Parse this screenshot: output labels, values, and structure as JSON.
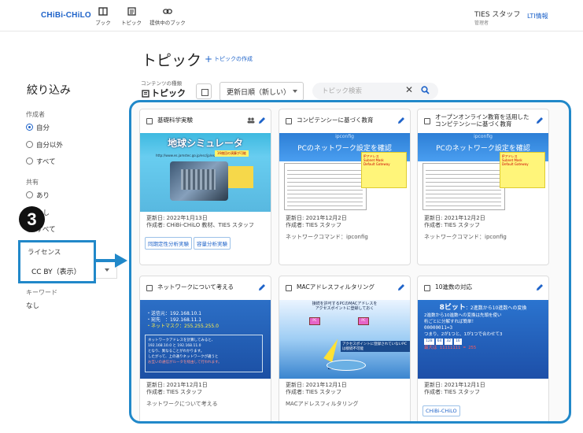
{
  "header": {
    "logo": "CHiBi-CHiLO",
    "nav": [
      {
        "label": "ブック",
        "icon": "book-icon"
      },
      {
        "label": "トピック",
        "icon": "topic-icon"
      },
      {
        "label": "提供中のブック",
        "icon": "link-icon"
      }
    ],
    "user_name": "TIES スタッフ",
    "user_role": "管理者",
    "lti_link": "LTI情報"
  },
  "page": {
    "title": "トピック",
    "add_topic": "トピックの作成"
  },
  "toolbar": {
    "content_type_label": "コンテンツの種類",
    "content_type_value": "トピック",
    "sort_value": "更新日順（新しい）",
    "search_placeholder": "トピック検索",
    "clear_icon": "✕"
  },
  "sidebar": {
    "title": "絞り込み",
    "author_label": "作成者",
    "author_options": [
      {
        "label": "自分",
        "selected": true
      },
      {
        "label": "自分以外",
        "selected": false
      },
      {
        "label": "すべて",
        "selected": false
      }
    ],
    "share_label": "共有",
    "share_options": [
      {
        "label": "あり",
        "selected": false
      },
      {
        "label": "なし",
        "selected": false
      },
      {
        "label": "すべて",
        "selected": false
      }
    ],
    "license_label": "ライセンス",
    "license_value": "CC BY（表示）",
    "keyword_label": "キーワード",
    "keyword_value": "なし"
  },
  "annotation": {
    "step": "3",
    "accent": "#2188c9"
  },
  "cards": [
    {
      "title": "基礎科学実験",
      "thumb_title": "地球シミュレータ",
      "thumb_strip": "http://www.es.jamstec.go.jp/esc/jp/es/hardware/index.html",
      "thumb_badge": "16億回の演算が可能",
      "updated": "更新日: 2022年1月13日",
      "author": "作成者: CHiBi-CHiLO 教材、TIES スタッフ",
      "tags": [
        "同期定性分析実験",
        "容量分析実験"
      ]
    },
    {
      "title": "コンピテンシーに基づく教育",
      "thumb_small": "ipconfig",
      "thumb_big": "PCのネットワーク設定を確認",
      "thumb_note": [
        "IPアドレス",
        "Subnet Mask",
        "Default Gateway"
      ],
      "updated": "更新日: 2021年12月2日",
      "author": "作成者: TIES スタッフ",
      "desc": "ネットワークコマンド：ipconfig"
    },
    {
      "title": "オープンオンライン教育を活用したコンピテンシーに基づく教育",
      "thumb_small": "ipconfig",
      "thumb_big": "PCのネットワーク設定を確認",
      "thumb_note": [
        "IPアドレス",
        "Subnet Mask",
        "Default Gateway"
      ],
      "updated": "更新日: 2021年12月2日",
      "author": "作成者: TIES スタッフ",
      "desc": "ネットワークコマンド：ipconfig"
    },
    {
      "title": "ネットワークについて考える",
      "thumb_lines": [
        "・送信元：192.168.10.1",
        "・宛先　：192.168.11.1",
        "・ネットマスク：255.255.255.0"
      ],
      "thumb_panel": [
        "ネットワークアドレスを計算してみると、",
        "192.168.10.0 と 192.168.11.0",
        "となり、異なることがわかります。",
        "したがって、上の通りネットワークが違うと",
        "お互いの通信がルータを経由して行われます。"
      ],
      "updated": "更新日: 2021年12月1日",
      "author": "作成者: TIES スタッフ",
      "desc": "ネットワークについて考える"
    },
    {
      "title": "MACアドレスフィルタリング",
      "thumb_header": [
        "接続を許可するPCのMACアドレスを",
        "アクセスポイントに登録しておく"
      ],
      "thumb_labels": [
        "アクセスポイントに登録されていないPCは接続不可能",
        "アクセスポイント"
      ],
      "updated": "更新日: 2021年12月1日",
      "author": "作成者: TIES スタッフ",
      "desc": "MACアドレスフィルタリング"
    },
    {
      "title": "10進数の対応",
      "thumb_title_big": "8ビット",
      "thumb_title_rest": "：2進数から10進数への変換",
      "thumb_body": [
        "2進数から10進数への変換は先頭を使い",
        "桁ごとに分解すれば簡単！"
      ],
      "thumb_bits": "00000011=3",
      "thumb_note": "つまり、2が1つと、1が1つで合わせて3",
      "thumb_boxes": [
        "128",
        "64",
        "32",
        "16"
      ],
      "thumb_max": "最大は 11111111 = 255",
      "updated": "更新日: 2021年12月1日",
      "author": "作成者: TIES スタッフ",
      "tags": [
        "CHiBi-CHiLO"
      ]
    }
  ]
}
